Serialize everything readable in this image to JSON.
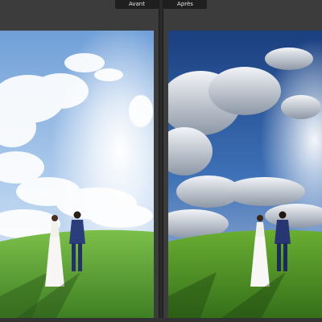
{
  "compare_view": {
    "before_label": "Avant",
    "after_label": "Après"
  },
  "colors": {
    "background": "#3a3a3a",
    "tab_background": "#1f1f1f",
    "tab_text": "#e6e6e6",
    "sky_before": "#8fb6e6",
    "sky_after": "#1f4f9a",
    "grass_before": "#5aa23a",
    "grass_after": "#4e9a28"
  }
}
